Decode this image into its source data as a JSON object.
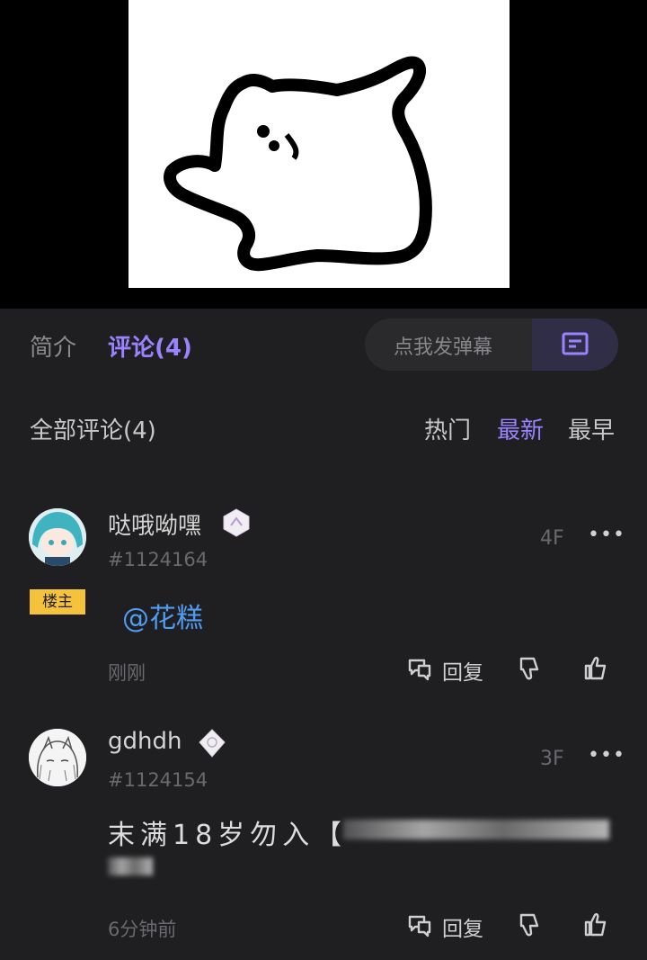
{
  "tabs": {
    "intro": "简介",
    "comments": "评论(4)"
  },
  "danmaku": {
    "placeholder": "点我发弹幕"
  },
  "filter": {
    "title": "全部评论(4)",
    "hot": "热门",
    "newest": "最新",
    "oldest": "最早"
  },
  "comments": [
    {
      "username": "哒哦呦嘿",
      "uid": "#1124164",
      "floor": "4F",
      "owner_tag": "楼主",
      "text": "@花糕",
      "time": "刚刚",
      "reply_label": "回复"
    },
    {
      "username": "gdhdh",
      "uid": "#1124154",
      "floor": "3F",
      "text": "末满18岁勿入【",
      "time": "6分钟前",
      "reply_label": "回复"
    }
  ],
  "colors": {
    "accent": "#9b82ff",
    "mention": "#4f9cf2",
    "owner_tag": "#f5c33b",
    "background": "#1f1f21"
  },
  "icons": [
    "danmaku-icon",
    "more-icon",
    "reply-icon",
    "dislike-icon",
    "like-icon",
    "badge-icon"
  ]
}
